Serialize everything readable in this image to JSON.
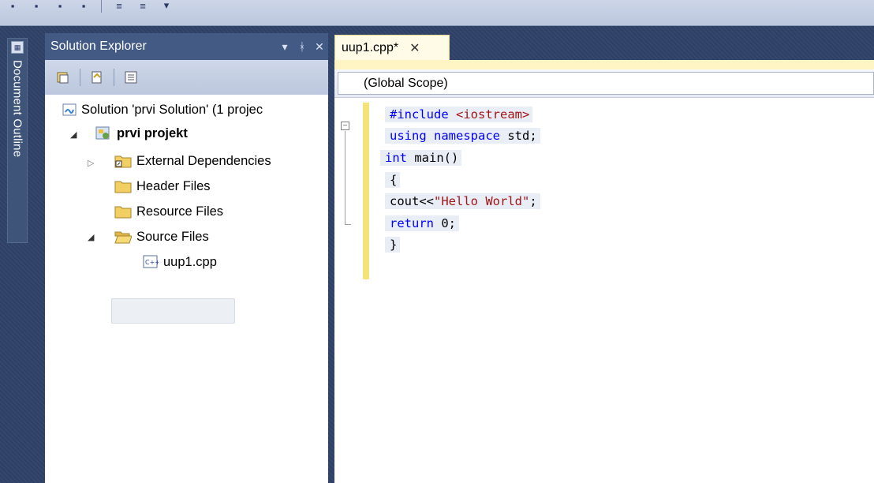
{
  "toolbar": {
    "icons": [
      "toolbar-icon-1",
      "toolbar-icon-2",
      "toolbar-icon-3",
      "toolbar-icon-4",
      "align-left-icon",
      "align-center-icon",
      "dropdown-icon"
    ]
  },
  "left_strip": {
    "document_outline_label": "Document Outline"
  },
  "solution_explorer": {
    "title": "Solution Explorer",
    "header_buttons": [
      "▾",
      "ᚼ",
      "✕"
    ],
    "tree": {
      "solution": "Solution 'prvi Solution' (1 projec",
      "project": "prvi projekt",
      "external_dependencies": "External Dependencies",
      "header_files": "Header Files",
      "resource_files": "Resource Files",
      "source_files": "Source Files",
      "file": "uup1.cpp"
    }
  },
  "editor": {
    "tab_label": "uup1.cpp*",
    "tab_close": "✕",
    "scope": "(Global Scope)",
    "code": {
      "l1_pp": "#include ",
      "l1_inc": "<iostream>",
      "l2_kw1": "using",
      "l2_kw2": "namespace",
      "l2_rest": " std;",
      "l3_kw": "int",
      "l3_rest": " main()",
      "l4": "{",
      "l5_a": "cout<<",
      "l5_str": "\"Hello World\"",
      "l5_b": ";",
      "l6_kw": "return",
      "l6_rest": " 0;",
      "l7": "}"
    },
    "collapse_symbol": "−"
  },
  "colors": {
    "ide_background": "#2e4066",
    "keyword": "#0000ff",
    "string": "#a31515",
    "change_bar": "#f5e27a"
  }
}
